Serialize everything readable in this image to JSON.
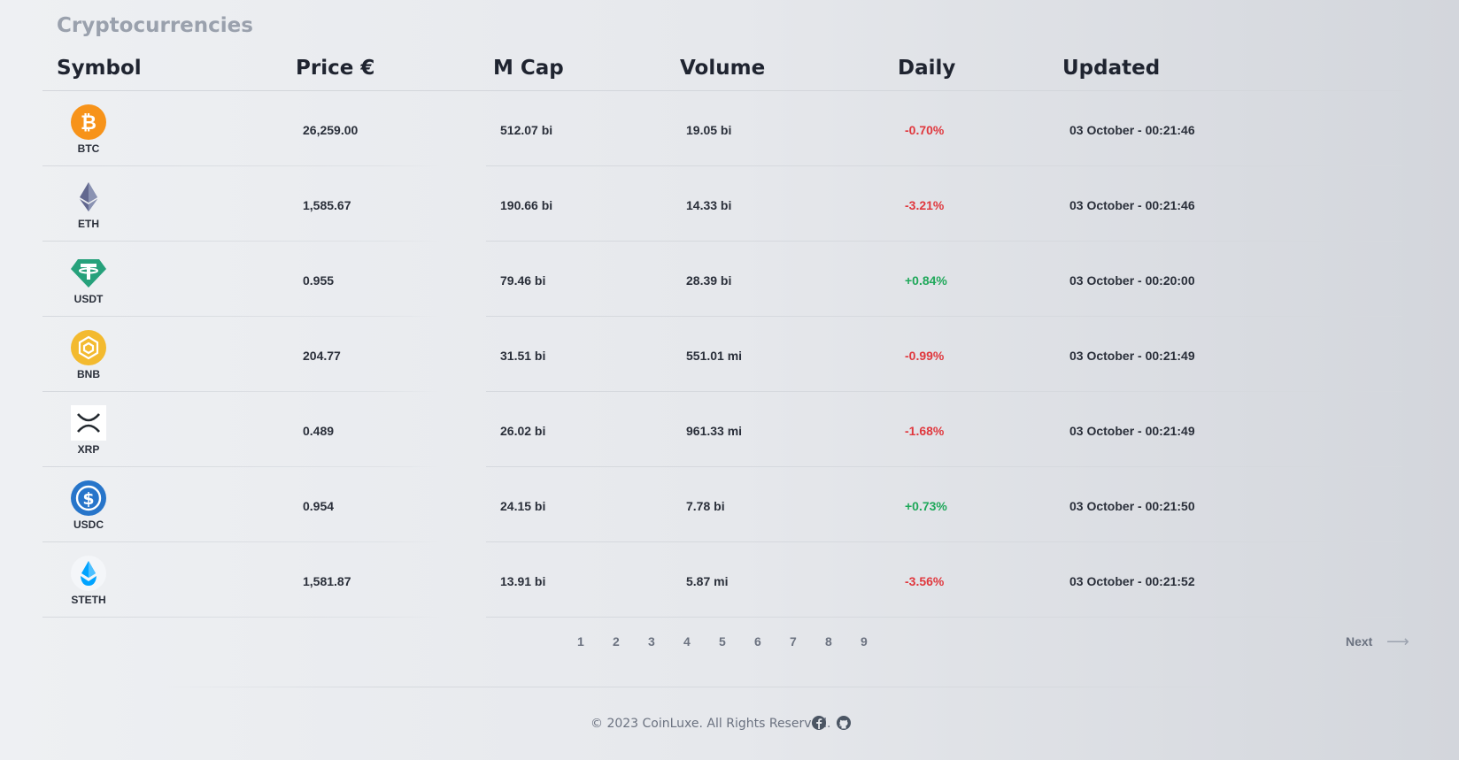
{
  "page": {
    "title": "Cryptocurrencies"
  },
  "table": {
    "headers": {
      "symbol": "Symbol",
      "price": "Price €",
      "mcap": "M Cap",
      "volume": "Volume",
      "daily": "Daily",
      "updated": "Updated"
    },
    "rows": [
      {
        "symbol": "BTC",
        "icon": "bitcoin-icon",
        "price": "26,259.00",
        "mcap": "512.07 bi",
        "volume": "19.05 bi",
        "daily": "-0.70%",
        "updated": "03 October - 00:21:46"
      },
      {
        "symbol": "ETH",
        "icon": "ethereum-icon",
        "price": "1,585.67",
        "mcap": "190.66 bi",
        "volume": "14.33 bi",
        "daily": "-3.21%",
        "updated": "03 October - 00:21:46"
      },
      {
        "symbol": "USDT",
        "icon": "tether-icon",
        "price": "0.955",
        "mcap": "79.46 bi",
        "volume": "28.39 bi",
        "daily": "+0.84%",
        "updated": "03 October - 00:20:00"
      },
      {
        "symbol": "BNB",
        "icon": "bnb-icon",
        "price": "204.77",
        "mcap": "31.51 bi",
        "volume": "551.01 mi",
        "daily": "-0.99%",
        "updated": "03 October - 00:21:49"
      },
      {
        "symbol": "XRP",
        "icon": "xrp-icon",
        "price": "0.489",
        "mcap": "26.02 bi",
        "volume": "961.33 mi",
        "daily": "-1.68%",
        "updated": "03 October - 00:21:49"
      },
      {
        "symbol": "USDC",
        "icon": "usdc-icon",
        "price": "0.954",
        "mcap": "24.15 bi",
        "volume": "7.78 bi",
        "daily": "+0.73%",
        "updated": "03 October - 00:21:50"
      },
      {
        "symbol": "STETH",
        "icon": "steth-icon",
        "price": "1,581.87",
        "mcap": "13.91 bi",
        "volume": "5.87 mi",
        "daily": "-3.56%",
        "updated": "03 October - 00:21:52"
      }
    ]
  },
  "pagination": {
    "pages": [
      "1",
      "2",
      "3",
      "4",
      "5",
      "6",
      "7",
      "8",
      "9"
    ],
    "next_label": "Next",
    "next_icon": "arrow-right-icon"
  },
  "footer": {
    "copyright": "© 2023 CoinLuxe. All Rights Reserved.",
    "icons": [
      "facebook-icon",
      "github-icon"
    ]
  },
  "colors": {
    "negative": "#e0383e",
    "positive": "#1fa85a",
    "bitcoin": "#f7931a",
    "tether": "#26a17b",
    "bnb": "#f3ba2f",
    "usdc": "#2775ca"
  }
}
